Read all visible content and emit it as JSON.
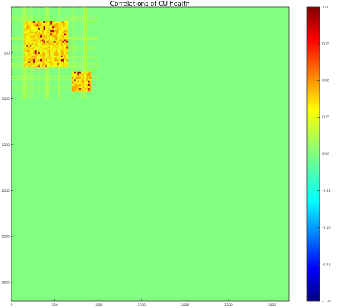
{
  "chart_data": {
    "type": "heatmap",
    "title": "Correlations of CU health",
    "xlabel": "",
    "ylabel": "",
    "xlim": [
      0,
      3200
    ],
    "ylim": [
      3200,
      0
    ],
    "x_ticks": [
      0,
      500,
      1000,
      1500,
      2000,
      2500,
      3000
    ],
    "y_ticks": [
      500,
      1000,
      1500,
      2000,
      2500,
      3000
    ],
    "colorbar": {
      "range": [
        -1.0,
        1.0
      ],
      "ticks": [
        "1.00",
        "0.75",
        "0.50",
        "0.25",
        "0.00",
        "-0.25",
        "-0.50",
        "-0.75",
        "-1.00"
      ],
      "tick_values": [
        1.0,
        0.75,
        0.5,
        0.25,
        0.0,
        -0.25,
        -0.5,
        -0.75,
        -1.0
      ],
      "colormap": "jet"
    },
    "background_value": 0.0,
    "correlated_blocks": [
      {
        "x_range": [
          150,
          650
        ],
        "y_range": [
          150,
          650
        ],
        "typical_value": 0.4,
        "peak_value": 0.9
      },
      {
        "x_range": [
          700,
          920
        ],
        "y_range": [
          700,
          920
        ],
        "typical_value": 0.45,
        "peak_value": 0.95
      }
    ],
    "grid": false
  }
}
